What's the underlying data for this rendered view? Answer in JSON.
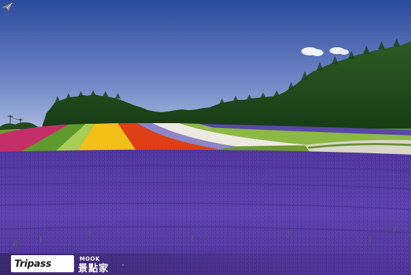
{
  "image": {
    "subject": "lavender-and-flower-field-landscape"
  },
  "watermark": {
    "logo_text": "Tripass",
    "publisher_small": "MOOK",
    "publisher_main": "景點家",
    "separator": "·"
  },
  "colors": {
    "sky_top": "#2f4f9e",
    "sky_bottom": "#a9b8dc",
    "forest": "#1f4a1c",
    "lavender": "#5b3fa6",
    "yellow_strip": "#f2c11a",
    "red_strip": "#e0401a",
    "white_strip": "#ecebe6",
    "pink_strip": "#c4306a",
    "green_strip": "#7fae3a"
  }
}
